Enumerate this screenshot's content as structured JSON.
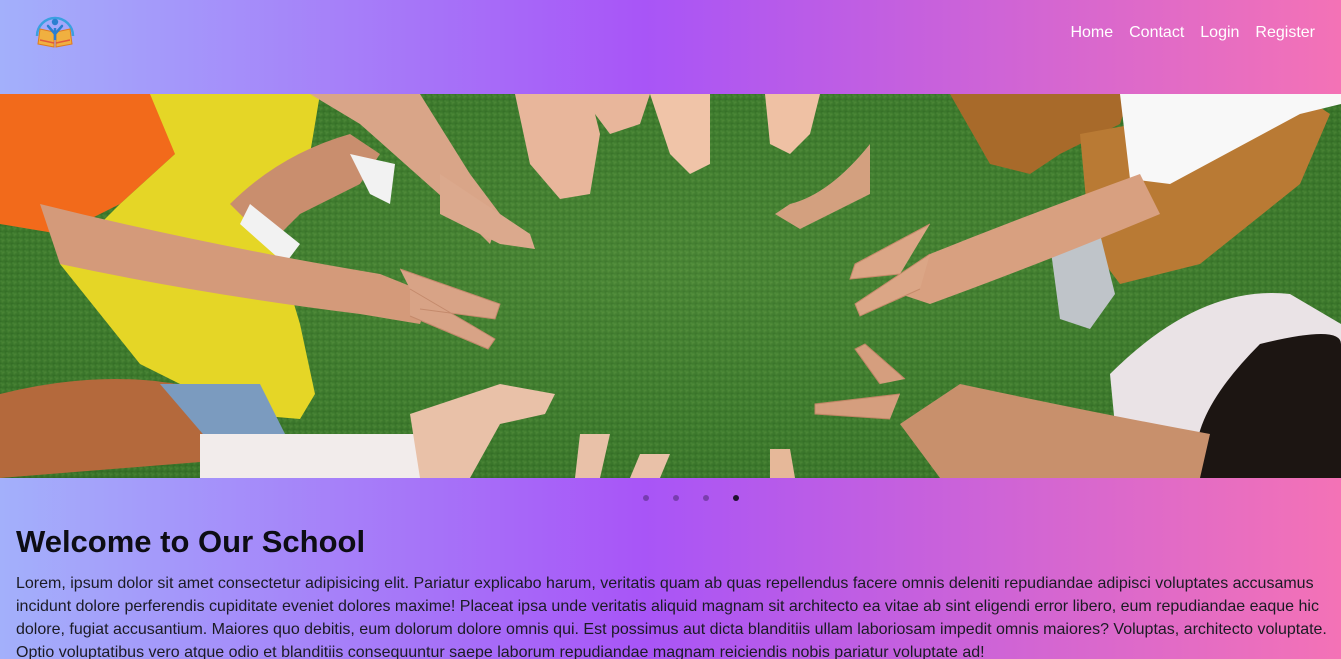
{
  "header": {
    "logo_icon": "school-book-logo-icon",
    "nav": {
      "home": "Home",
      "contact": "Contact",
      "login": "Login",
      "register": "Register"
    }
  },
  "hero": {
    "image_subject": "children-hands-on-grass-photo"
  },
  "carousel": {
    "slide_count": 4,
    "active_index": 3
  },
  "main": {
    "title": "Welcome to Our School",
    "body": "Lorem, ipsum dolor sit amet consectetur adipisicing elit. Pariatur explicabo harum, veritatis quam ab quas repellendus facere omnis deleniti repudiandae adipisci voluptates accusamus incidunt dolore perferendis cupiditate eveniet dolores maxime! Placeat ipsa unde veritatis aliquid magnam sit architecto ea vitae ab sint eligendi error libero, eum repudiandae eaque hic dolore, fugiat accusantium. Maiores quo debitis, eum dolorum dolore omnis qui. Est possimus aut dicta blanditiis ullam laboriosam impedit omnis maiores? Voluptas, architecto voluptate. Optio voluptatibus vero atque odio et blanditiis consequuntur saepe laborum repudiandae magnam reiciendis nobis pariatur voluptate ad!"
  },
  "colors": {
    "gradient_left": "#a3b0fb",
    "gradient_mid": "#a855f7",
    "gradient_right": "#f472b6",
    "nav_text": "#ffffff"
  }
}
